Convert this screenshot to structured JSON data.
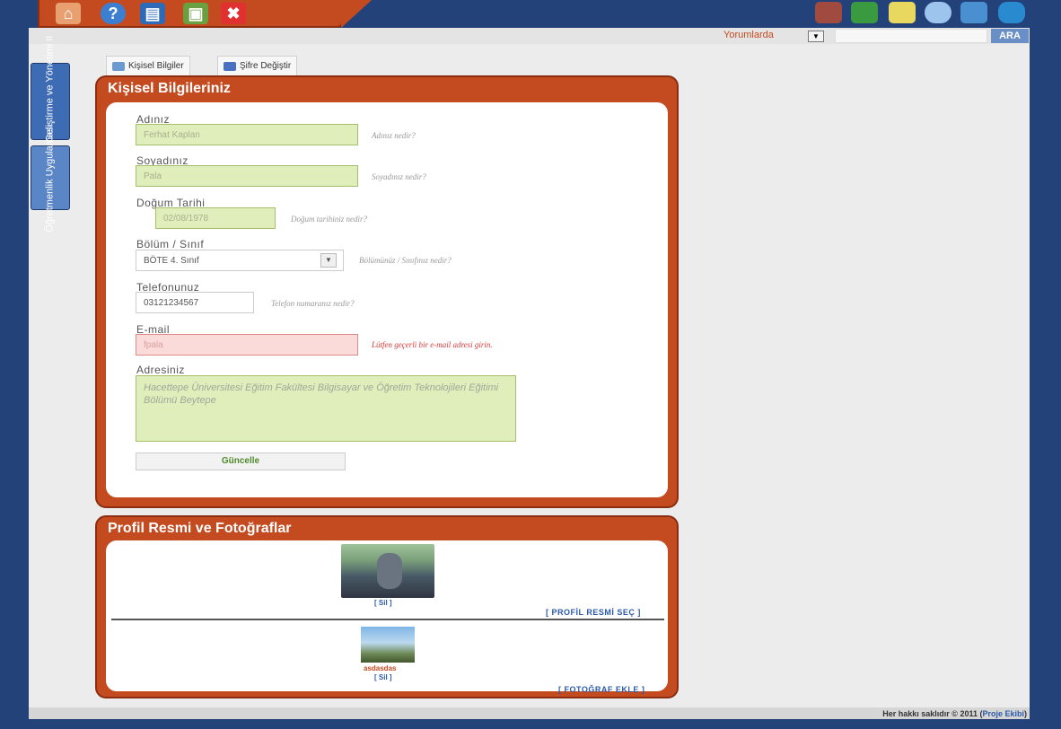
{
  "search": {
    "scope": "Yorumlarda",
    "button": "ARA"
  },
  "sidebar": {
    "tabs": [
      "Proje Geliştirme ve Yönetimi II",
      "Öğretmenlik Uygulaması"
    ]
  },
  "subtabs": {
    "personal": "Kişisel Bilgiler",
    "password": "Şifre Değiştir"
  },
  "personal": {
    "title": "Kişisel Bilgileriniz",
    "name": {
      "label": "Adınız",
      "value": "Ferhat Kaplan",
      "hint": "Adınız nedir?"
    },
    "surname": {
      "label": "Soyadınız",
      "value": "Pala",
      "hint": "Soyadınız nedir?"
    },
    "birth": {
      "label": "Doğum Tarihi",
      "value": "02/08/1978",
      "hint": "Doğum tarihiniz nedir?"
    },
    "dept": {
      "label": "Bölüm / Sınıf",
      "value": "BÖTE 4. Sınıf",
      "hint": "Bölümünüz / Sınıfınız nedir?"
    },
    "phone": {
      "label": "Telefonunuz",
      "value": "03121234567",
      "hint": "Telefon numaranız nedir?"
    },
    "email": {
      "label": "E-mail",
      "value": "fpala",
      "hint": "Lütfen geçerli bir e-mail adresi girin."
    },
    "address": {
      "label": "Adresiniz",
      "value": "Hacettepe Üniversitesi Eğitim Fakültesi Bilgisayar ve Öğretim Teknolojileri Eğitimi Bölümü Beytepe"
    },
    "submit": "Güncelle"
  },
  "photos": {
    "title": "Profil Resmi ve Fotoğraflar",
    "profile_delete": "[ Sil ]",
    "select_profile": "[ PROFİL RESMİ SEÇ ]",
    "photo_caption": "asdasdas",
    "photo_delete": "[ Sil ]",
    "add_photo": "[ FOTOĞRAF EKLE ]"
  },
  "footer": {
    "text": "Her hakkı saklıdır © 2011 (",
    "link": "Proje Ekibi",
    "close": ")"
  },
  "colors": {
    "accent": "#c44a20",
    "nav": "#24427a",
    "ok_green": "#dfeebb",
    "error_red": "#fbdada"
  },
  "icons": {
    "top_left": [
      "home-icon",
      "help-icon",
      "profile-card-icon",
      "print-icon",
      "close-icon"
    ],
    "top_right": [
      "graduation-icon",
      "books-icon",
      "notes-icon",
      "chat-icon",
      "media-icon",
      "arrows-icon"
    ]
  }
}
